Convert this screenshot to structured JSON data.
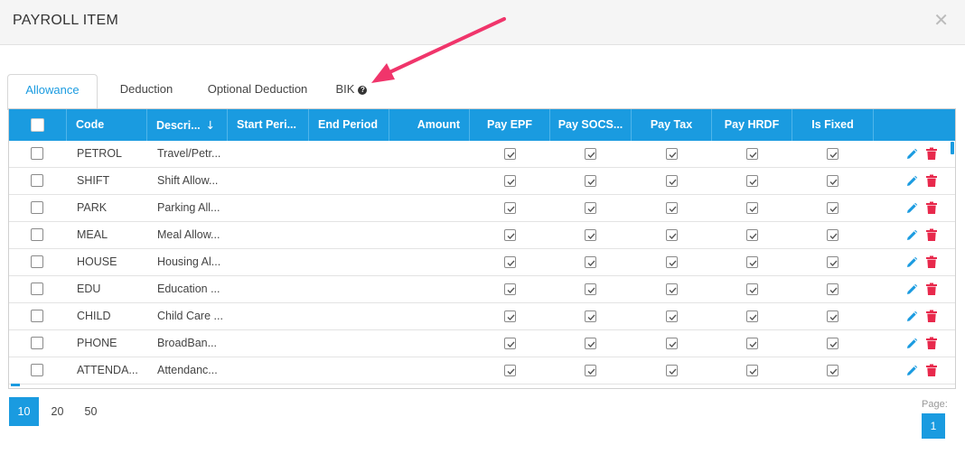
{
  "dialog": {
    "title": "PAYROLL ITEM",
    "close_glyph": "✕"
  },
  "tabs": [
    {
      "label": "Allowance",
      "active": true
    },
    {
      "label": "Deduction",
      "active": false
    },
    {
      "label": "Optional Deduction",
      "active": false
    },
    {
      "label": "BIK",
      "active": false,
      "help_glyph": "?"
    }
  ],
  "grid": {
    "columns": [
      "Code",
      "Descri...",
      "Start Peri...",
      "End Period",
      "Amount",
      "Pay EPF",
      "Pay SOCS...",
      "Pay Tax",
      "Pay HRDF",
      "Is Fixed"
    ],
    "sort_glyph": "↓",
    "rows": [
      {
        "code": "PETROL",
        "description": "Travel/Petr...",
        "start_period": "",
        "end_period": "",
        "amount": "",
        "pay_epf": true,
        "pay_socso": true,
        "pay_tax": true,
        "pay_hrdf": true,
        "is_fixed": true
      },
      {
        "code": "SHIFT",
        "description": "Shift Allow...",
        "start_period": "",
        "end_period": "",
        "amount": "",
        "pay_epf": true,
        "pay_socso": true,
        "pay_tax": true,
        "pay_hrdf": true,
        "is_fixed": true
      },
      {
        "code": "PARK",
        "description": "Parking All...",
        "start_period": "",
        "end_period": "",
        "amount": "",
        "pay_epf": true,
        "pay_socso": true,
        "pay_tax": true,
        "pay_hrdf": true,
        "is_fixed": true
      },
      {
        "code": "MEAL",
        "description": "Meal Allow...",
        "start_period": "",
        "end_period": "",
        "amount": "",
        "pay_epf": true,
        "pay_socso": true,
        "pay_tax": true,
        "pay_hrdf": true,
        "is_fixed": true
      },
      {
        "code": "HOUSE",
        "description": "Housing Al...",
        "start_period": "",
        "end_period": "",
        "amount": "",
        "pay_epf": true,
        "pay_socso": true,
        "pay_tax": true,
        "pay_hrdf": true,
        "is_fixed": true
      },
      {
        "code": "EDU",
        "description": "Education ...",
        "start_period": "",
        "end_period": "",
        "amount": "",
        "pay_epf": true,
        "pay_socso": true,
        "pay_tax": true,
        "pay_hrdf": true,
        "is_fixed": true
      },
      {
        "code": "CHILD",
        "description": "Child Care ...",
        "start_period": "",
        "end_period": "",
        "amount": "",
        "pay_epf": true,
        "pay_socso": true,
        "pay_tax": true,
        "pay_hrdf": true,
        "is_fixed": true
      },
      {
        "code": "PHONE",
        "description": "BroadBan...",
        "start_period": "",
        "end_period": "",
        "amount": "",
        "pay_epf": true,
        "pay_socso": true,
        "pay_tax": true,
        "pay_hrdf": true,
        "is_fixed": true
      },
      {
        "code": "ATTENDA...",
        "description": "Attendanc...",
        "start_period": "",
        "end_period": "",
        "amount": "",
        "pay_epf": true,
        "pay_socso": true,
        "pay_tax": true,
        "pay_hrdf": true,
        "is_fixed": true
      }
    ]
  },
  "pager": {
    "page_sizes": [
      "10",
      "20",
      "50"
    ],
    "active_page_size": "10",
    "page_label": "Page:",
    "current_page": "1"
  },
  "colors": {
    "accent": "#1a9be0",
    "delete": "#e8294c",
    "arrow": "#f0356b"
  },
  "icons": {
    "edit": "pencil-icon",
    "delete": "trash-icon",
    "close": "close-icon",
    "help": "question-circle-icon",
    "sort": "arrow-down-icon"
  }
}
